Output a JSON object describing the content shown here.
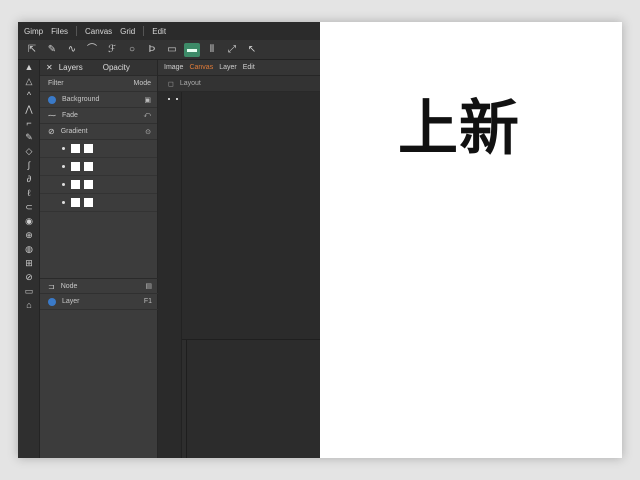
{
  "menubar": {
    "items": [
      "Gimp",
      "Files",
      "Canvas",
      "Grid",
      "Edit"
    ]
  },
  "toolbar": {
    "icons": [
      "pointer-icon",
      "brush-icon",
      "wave-icon",
      "curve-icon",
      "path-icon",
      "circle-icon",
      "text-icon",
      "rectangle-icon",
      "layer-active-icon",
      "align-icon",
      "arrow-icon",
      "cursor-icon"
    ]
  },
  "tools": [
    "▲",
    "△",
    "^",
    "⋀",
    "⌐",
    "✎",
    "◇",
    "∫",
    "∂",
    "ℓ",
    "⊂",
    "◉",
    "⊕",
    "◍",
    "⊞",
    "⊘",
    "▭",
    "⌂"
  ],
  "layers": {
    "header": {
      "close": "✕",
      "title": "Layers",
      "right": "Opacity"
    },
    "filter": {
      "left": "Filter",
      "right": "Mode"
    },
    "rows": [
      {
        "label": "Background",
        "end": "▣"
      },
      {
        "label": "Fade",
        "end": "⤺"
      },
      {
        "label": "Gradient",
        "end": "⊙"
      }
    ],
    "bottom": [
      {
        "label": "Node",
        "end": "▤"
      },
      {
        "label": "Layer",
        "end": "F1"
      }
    ]
  },
  "canvas": {
    "tabs": [
      "Image",
      "Canvas",
      "Layer",
      "Edit"
    ],
    "header": [
      "◻",
      "Layout"
    ]
  },
  "headline": "上新"
}
